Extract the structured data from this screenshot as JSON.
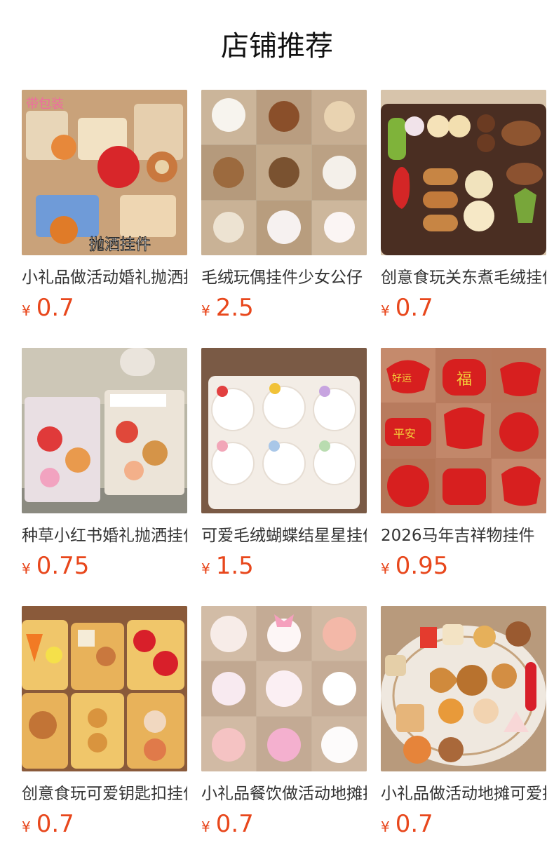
{
  "section": {
    "title": "店铺推荐"
  },
  "currency_symbol": "¥",
  "colors": {
    "price": "#e8471c",
    "title": "#111111",
    "name": "#333333"
  },
  "products": [
    {
      "name": "小礼品做活动婚礼抛洒挂件",
      "price": "0.7",
      "image_overlay_text": "带包装",
      "image_caption": "抛洒挂件"
    },
    {
      "name": "毛绒玩偶挂件少女公仔",
      "price": "2.5"
    },
    {
      "name": "创意食玩关东煮毛绒挂件",
      "price": "0.7"
    },
    {
      "name": "种草小红书婚礼抛洒挂件",
      "price": "0.75"
    },
    {
      "name": "可爱毛绒蝴蝶结星星挂件",
      "price": "1.5"
    },
    {
      "name": "2026马年吉祥物挂件",
      "price": "0.95",
      "image_tag_1": "好运",
      "image_tag_2": "福",
      "image_tag_3": "平安"
    },
    {
      "name": "创意食玩可爱钥匙扣挂件",
      "price": "0.7"
    },
    {
      "name": "小礼品餐饮做活动地摊挂件",
      "price": "0.7"
    },
    {
      "name": "小礼品做活动地摊可爱挂件",
      "price": "0.7"
    }
  ]
}
